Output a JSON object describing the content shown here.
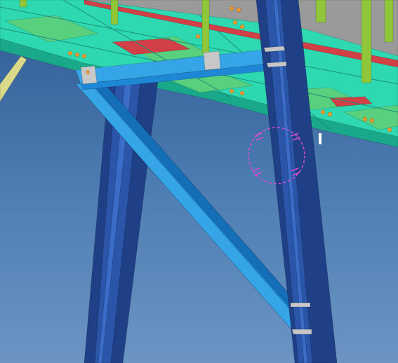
{
  "viewport": {
    "view_mode": "3d-model-view",
    "background": {
      "top": "#2e5a93",
      "mid": "#4f7fb4",
      "bottom": "#6b94c3"
    },
    "colors": {
      "column_dark": "#1f3f86",
      "column_mid": "#2a55a8",
      "column_light": "#3a6cc8",
      "beam_light": "#36a5e8",
      "beam_mid": "#1f88d6",
      "beam_dark": "#156fb8",
      "deck_plate": "#2ed9b2",
      "deck_shadow": "#1aa88a",
      "grating_green": "#58d07e",
      "handrail_green": "#8fc63a",
      "handrail_grey": "#9a9a9a",
      "red_strip": "#d23f46",
      "bolt_orange": "#f29a2e",
      "clip_plate": "#c7c7c7",
      "selection_circle": "#d64dd3",
      "yellow_member": "#d9d98a"
    },
    "objects": [
      "platform-deck",
      "handrail",
      "steel-column-left",
      "steel-column-right",
      "horizontal-beam",
      "diagonal-brace",
      "bolt-group",
      "clip-angle",
      "selection-marker"
    ]
  }
}
